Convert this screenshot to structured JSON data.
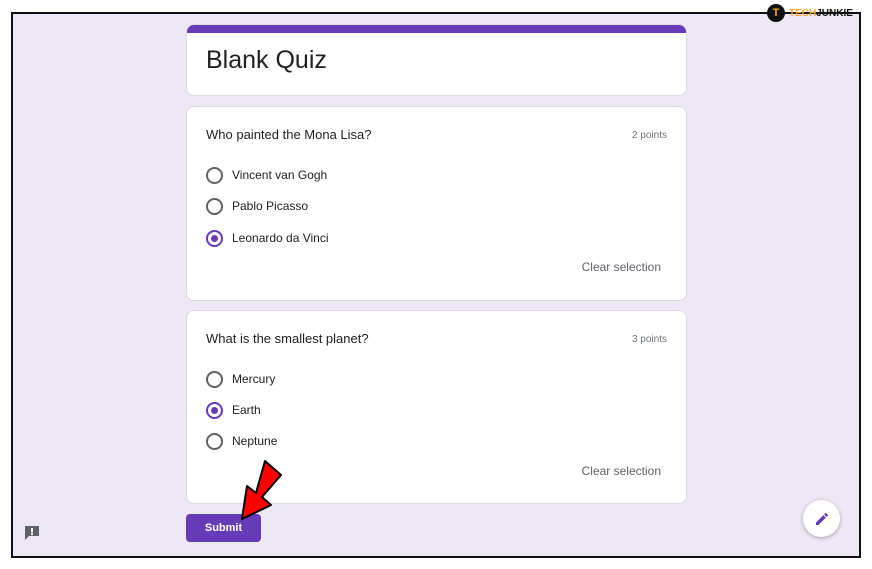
{
  "form": {
    "title": "Blank Quiz",
    "accent_color": "#673ab7",
    "background_color": "#ede7f6"
  },
  "questions": [
    {
      "text": "Who painted the Mona Lisa?",
      "points": "2 points",
      "options": [
        {
          "label": "Vincent van Gogh",
          "selected": false
        },
        {
          "label": "Pablo Picasso",
          "selected": false
        },
        {
          "label": "Leonardo da Vinci",
          "selected": true
        }
      ],
      "clear_label": "Clear selection"
    },
    {
      "text": "What is the smallest planet?",
      "points": "3 points",
      "options": [
        {
          "label": "Mercury",
          "selected": false
        },
        {
          "label": "Earth",
          "selected": true
        },
        {
          "label": "Neptune",
          "selected": false
        }
      ],
      "clear_label": "Clear selection"
    }
  ],
  "submit_label": "Submit",
  "watermark": {
    "logo_letter": "T",
    "brand_part1": "TECH",
    "brand_part2": "JUNKIE"
  },
  "icons": {
    "report": "report-feedback-icon",
    "edit": "pencil-edit-icon",
    "annotation": "red-arrow-icon"
  }
}
